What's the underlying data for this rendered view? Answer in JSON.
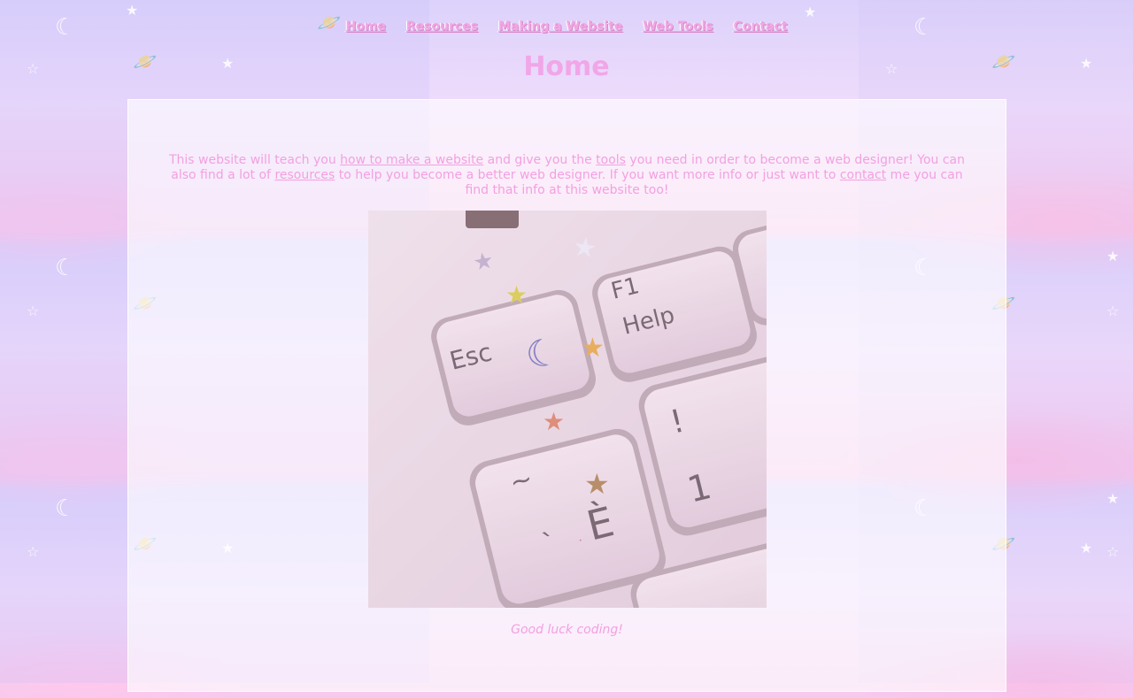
{
  "nav": {
    "items": [
      {
        "label": "Home"
      },
      {
        "label": "Resources"
      },
      {
        "label": "Making a Website"
      },
      {
        "label": "Web Tools"
      },
      {
        "label": "Contact"
      }
    ]
  },
  "page_title": "Home",
  "intro": {
    "t1": "This website will teach you ",
    "link_make": "how to make a website",
    "t2": " and give you the ",
    "link_tools": "tools",
    "t3": " you need in order to become a web designer! You can also find a lot of ",
    "link_resources": "resources",
    "t4": " to help you become a better web designer. If you want more info or just want to ",
    "link_contact": "contact",
    "t5": " me you can find that info at this website too!"
  },
  "photo": {
    "esc_key": "Esc",
    "f1_key": "F1",
    "help_key": "Help",
    "exclaim_key": "!",
    "one_key": "1",
    "tilde_key": "~",
    "backtick_key": "`",
    "e_key": "È"
  },
  "caption": "Good luck coding!",
  "colors": {
    "accent_pink": "#f3a0e0",
    "title_pink": "#f1a6e8",
    "bg_lavender": "#dcd2fb",
    "bg_pink": "#f6c9ec"
  }
}
